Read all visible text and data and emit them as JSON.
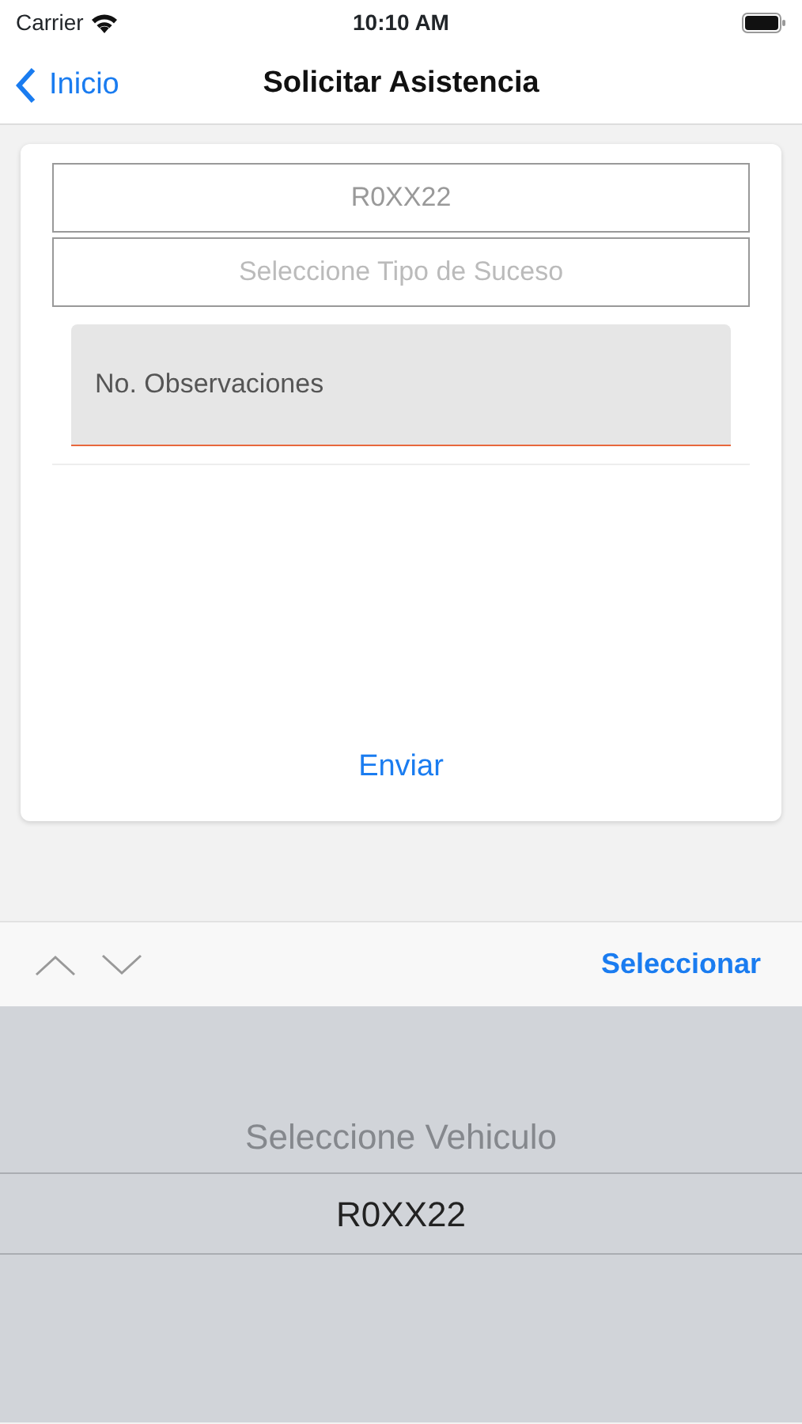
{
  "status_bar": {
    "carrier": "Carrier",
    "time": "10:10 AM"
  },
  "nav": {
    "back": "Inicio",
    "title": "Solicitar Asistencia"
  },
  "form": {
    "vehicle_field": {
      "value": "R0XX22"
    },
    "event_type_field": {
      "placeholder": "Seleccione Tipo de Suceso"
    },
    "notes_field": {
      "placeholder": "No. Observaciones"
    },
    "submit": "Enviar"
  },
  "toolbar": {
    "done": "Seleccionar"
  },
  "picker": [
    {
      "label": "Seleccione Vehiculo",
      "selected": false
    },
    {
      "label": "R0XX22",
      "selected": true
    }
  ]
}
